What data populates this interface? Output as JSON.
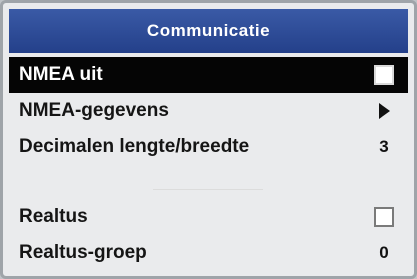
{
  "title": "Communicatie",
  "menu": {
    "items": [
      {
        "label": "NMEA uit",
        "control": "checkbox",
        "selected": true
      },
      {
        "label": "NMEA-gegevens",
        "control": "submenu-arrow"
      },
      {
        "label": "Decimalen lengte/breedte",
        "control": "value",
        "value": "3"
      },
      {
        "label": "Realtus",
        "control": "checkbox"
      },
      {
        "label": "Realtus-groep",
        "control": "value",
        "value": "0"
      }
    ]
  },
  "colors": {
    "titlebar": "#2e4c98",
    "selection": "#050505",
    "background": "#eaebed"
  },
  "icons": [
    "checkbox-icon",
    "submenu-arrow-icon"
  ]
}
